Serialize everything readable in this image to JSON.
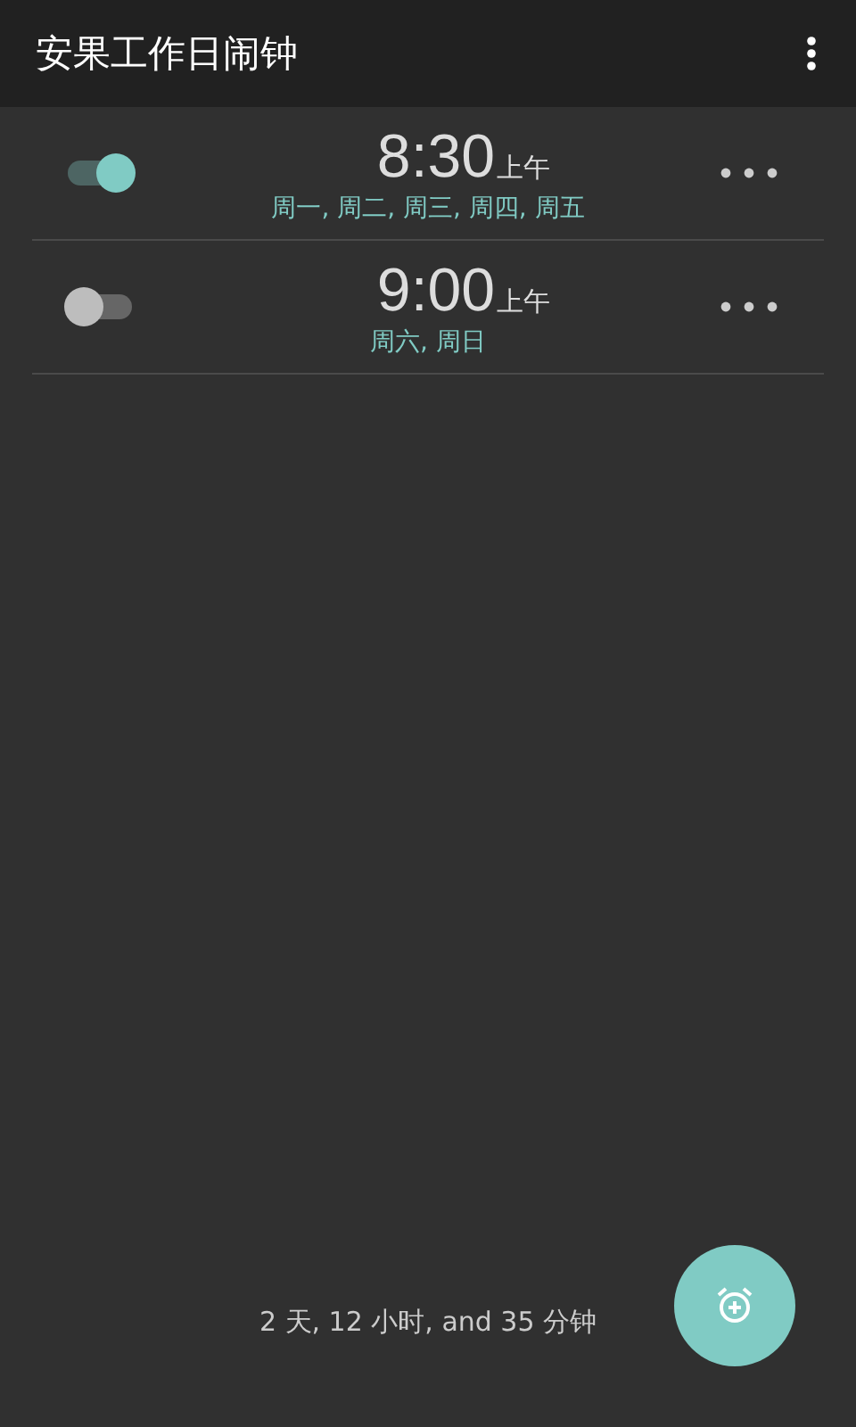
{
  "app_bar": {
    "title": "安果工作日闹钟"
  },
  "alarms": [
    {
      "enabled": true,
      "time": "8:30",
      "period": "上午",
      "days": "周一, 周二, 周三, 周四, 周五"
    },
    {
      "enabled": false,
      "time": "9:00",
      "period": "上午",
      "days": "周六, 周日"
    }
  ],
  "next_alarm": "2 天, 12 小时, and 35 分钟"
}
